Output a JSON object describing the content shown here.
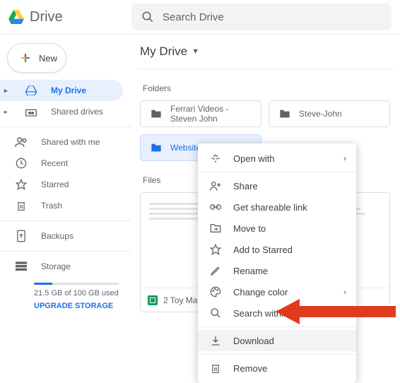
{
  "brand": "Drive",
  "search": {
    "placeholder": "Search Drive"
  },
  "new_label": "New",
  "sidebar": {
    "items": [
      {
        "label": "My Drive"
      },
      {
        "label": "Shared drives"
      },
      {
        "label": "Shared with me"
      },
      {
        "label": "Recent"
      },
      {
        "label": "Starred"
      },
      {
        "label": "Trash"
      },
      {
        "label": "Backups"
      },
      {
        "label": "Storage"
      }
    ],
    "storage_used": "21.5 GB of 100 GB used",
    "upgrade": "UPGRADE STORAGE"
  },
  "breadcrumb": "My Drive",
  "section_folders": "Folders",
  "section_files": "Files",
  "folders": [
    {
      "name": "Ferrari Videos - Steven John"
    },
    {
      "name": "Steve-John"
    },
    {
      "name": "Website #1"
    }
  ],
  "files": [
    {
      "name": "2 Toy Mat"
    }
  ],
  "context_menu": {
    "open_with": "Open with",
    "share": "Share",
    "get_link": "Get shareable link",
    "move_to": "Move to",
    "add_starred": "Add to Starred",
    "rename": "Rename",
    "change_color": "Change color",
    "search_within": "Search within Website #1",
    "download": "Download",
    "remove": "Remove"
  }
}
